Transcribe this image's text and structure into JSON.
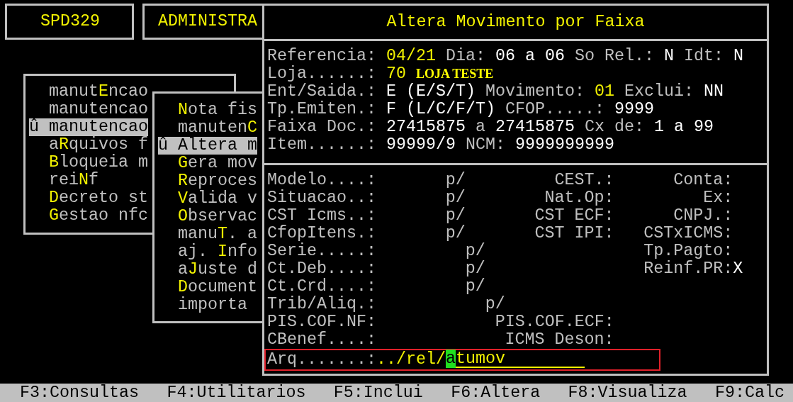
{
  "program_box": {
    "text": "SPD329"
  },
  "module_box": {
    "text": "ADMINISTRA"
  },
  "main_menu": {
    "items": [
      {
        "label": "manut**E**ncao",
        "selected": false
      },
      {
        "label": "manutencao",
        "selected": false
      },
      {
        "label": "manutencao",
        "selected": true,
        "marker": "û"
      },
      {
        "label": "a**R**quivos f",
        "selected": false
      },
      {
        "label": "**B**loqueia m",
        "selected": false
      },
      {
        "label": "rei**N**f",
        "selected": false
      },
      {
        "label": "**D**ecreto st",
        "selected": false
      },
      {
        "label": "**G**estao nfc",
        "selected": false
      }
    ]
  },
  "sub_menu": {
    "items": [
      {
        "label": "**N**ota fis",
        "selected": false
      },
      {
        "label": "manuten**C**",
        "selected": false
      },
      {
        "label": "Altera m",
        "selected": true,
        "marker": "û"
      },
      {
        "label": "**G**era mov",
        "selected": false
      },
      {
        "label": "**R**eproces",
        "selected": false
      },
      {
        "label": "**V**alida v",
        "selected": false
      },
      {
        "label": "**O**bservac",
        "selected": false
      },
      {
        "label": "manu**T**. a",
        "selected": false
      },
      {
        "label": "aj. **I**nfo",
        "selected": false
      },
      {
        "label": "a**J**uste d",
        "selected": false
      },
      {
        "label": "**D**ocument",
        "selected": false
      },
      {
        "label": "importa",
        "selected": false
      }
    ]
  },
  "dialog": {
    "title": "Altera Movimento por Faixa",
    "header_rows": [
      [
        {
          "kind": "label",
          "text": "Referencia:"
        },
        {
          "kind": "accent",
          "text": "04/21"
        },
        {
          "kind": "label",
          "text": "Dia:"
        },
        {
          "kind": "value",
          "text": "06 a 06"
        },
        {
          "kind": "label",
          "text": "So Rel.:"
        },
        {
          "kind": "value",
          "text": "N"
        },
        {
          "kind": "label",
          "text": "Idt:"
        },
        {
          "kind": "value",
          "text": "N"
        }
      ],
      [
        {
          "kind": "label",
          "text": "Loja......:"
        },
        {
          "kind": "accent",
          "text": "70"
        },
        {
          "kind": "name",
          "text": "LOJA TESTE"
        }
      ],
      [
        {
          "kind": "label",
          "text": "Ent/Saida.:"
        },
        {
          "kind": "value",
          "text": "E (E/S/T)"
        },
        {
          "kind": "label",
          "text": "Movimento:"
        },
        {
          "kind": "accent",
          "text": "01"
        },
        {
          "kind": "label",
          "text": "Exclui:"
        },
        {
          "kind": "value",
          "text": "NN"
        }
      ],
      [
        {
          "kind": "label",
          "text": "Tp.Emiten.:"
        },
        {
          "kind": "value",
          "text": "F (L/C/F/T)"
        },
        {
          "kind": "label",
          "text": "CFOP.....:"
        },
        {
          "kind": "value",
          "text": "9999"
        }
      ],
      [
        {
          "kind": "label",
          "text": "Faixa Doc.:"
        },
        {
          "kind": "value",
          "text": "27415875"
        },
        {
          "kind": "label",
          "text": "a"
        },
        {
          "kind": "value",
          "text": "27415875"
        },
        {
          "kind": "label",
          "text": "Cx de:"
        },
        {
          "kind": "value",
          "text": "1 a 99"
        }
      ],
      [
        {
          "kind": "label",
          "text": "Item......:"
        },
        {
          "kind": "value",
          "text": "99999/9"
        },
        {
          "kind": "label",
          "text": "NCM:"
        },
        {
          "kind": "value",
          "text": "9999999999"
        }
      ]
    ],
    "filter_rows": [
      {
        "label": "Modelo....:",
        "range": "p/",
        "middle": "CEST.:",
        "right": "Conta:"
      },
      {
        "label": "Situacao..:",
        "range": "p/",
        "middle": "Nat.Op:",
        "right": "Ex:"
      },
      {
        "label": "CST Icms..:",
        "range": "p/",
        "middle": "CST ECF:",
        "right": "CNPJ.:"
      },
      {
        "label": "CfopItens.:",
        "range": "p/",
        "middle": "CST IPI:",
        "right": "CSTxICMS:"
      },
      {
        "label": "Serie.....:",
        "range": "p/",
        "right": "Tp.Pagto:"
      },
      {
        "label": "Ct.Deb....:",
        "range": "p/",
        "right": "Reinf.PR:",
        "right_value": "X"
      },
      {
        "label": "Ct.Crd....:",
        "range": "p/"
      },
      {
        "label": "Trib/Aliq.:",
        "range": "p/"
      },
      {
        "label": "PIS.COF.NF:",
        "middle": "PIS.COF.ECF:"
      },
      {
        "label": "CBenef....:",
        "middle": "ICMS Deson:"
      }
    ],
    "file_row": {
      "label": "Arq.......:",
      "prefix": "../rel/",
      "value": "atumov"
    }
  },
  "function_keys": [
    "F3:Consultas",
    "F4:Utilitarios",
    "F5:Inclui",
    "F6:Altera",
    "F8:Visualiza",
    "F9:Calc"
  ]
}
